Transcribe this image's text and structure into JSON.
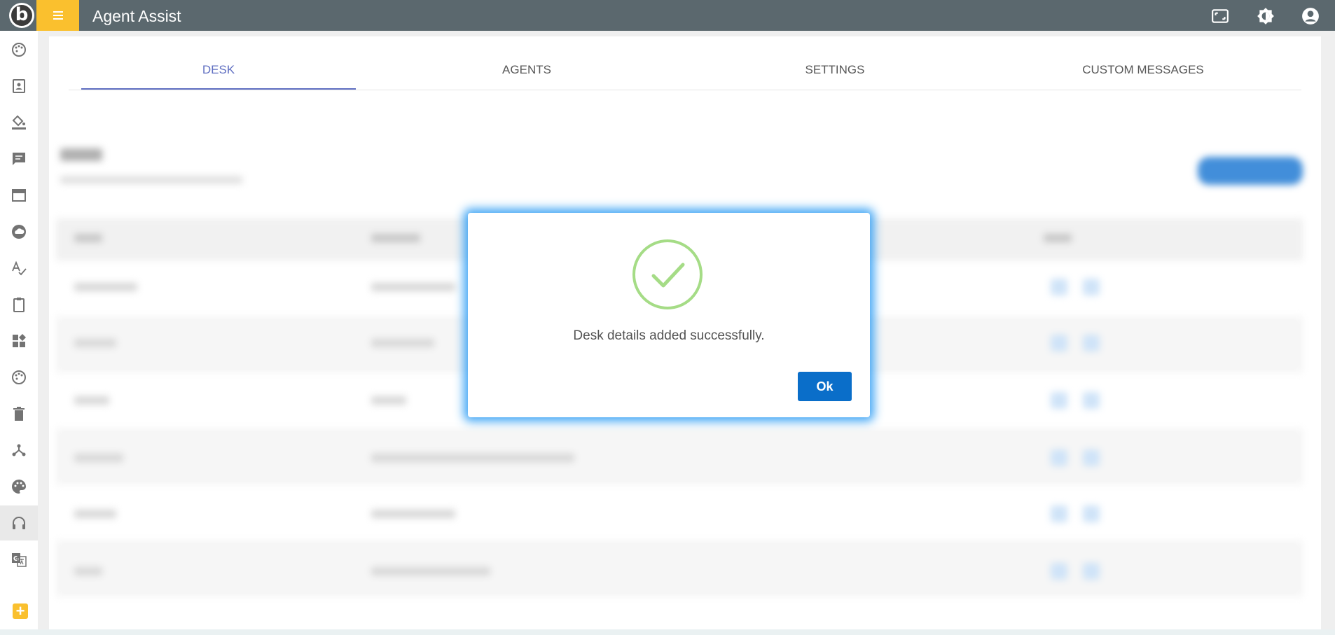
{
  "header": {
    "logo_letter": "b",
    "title": "Agent Assist"
  },
  "tabs": [
    {
      "label": "DESK",
      "active": true
    },
    {
      "label": "AGENTS",
      "active": false
    },
    {
      "label": "SETTINGS",
      "active": false
    },
    {
      "label": "CUSTOM MESSAGES",
      "active": false
    }
  ],
  "sidebar": {
    "items": [
      {
        "icon": "palette-dots-icon"
      },
      {
        "icon": "contact-card-icon"
      },
      {
        "icon": "paint-bucket-icon"
      },
      {
        "icon": "chat-icon"
      },
      {
        "icon": "browser-window-icon"
      },
      {
        "icon": "cloud-icon"
      },
      {
        "icon": "spellcheck-icon"
      },
      {
        "icon": "clipboard-icon"
      },
      {
        "icon": "dashboard-icon"
      },
      {
        "icon": "palette-dots-icon"
      },
      {
        "icon": "trash-icon"
      },
      {
        "icon": "hub-icon"
      },
      {
        "icon": "palette-icon"
      },
      {
        "icon": "headset-icon",
        "active": true
      },
      {
        "icon": "translate-icon"
      }
    ],
    "add_icon": "plus-icon"
  },
  "dialog": {
    "message": "Desk details added successfully.",
    "ok_label": "Ok",
    "icon": "success-check-icon"
  },
  "colors": {
    "topbar": "#37474f",
    "accent": "#f9b200",
    "tab_active": "#3f51b5",
    "ok_button": "#0a6ec9",
    "success": "#a5dc86"
  }
}
